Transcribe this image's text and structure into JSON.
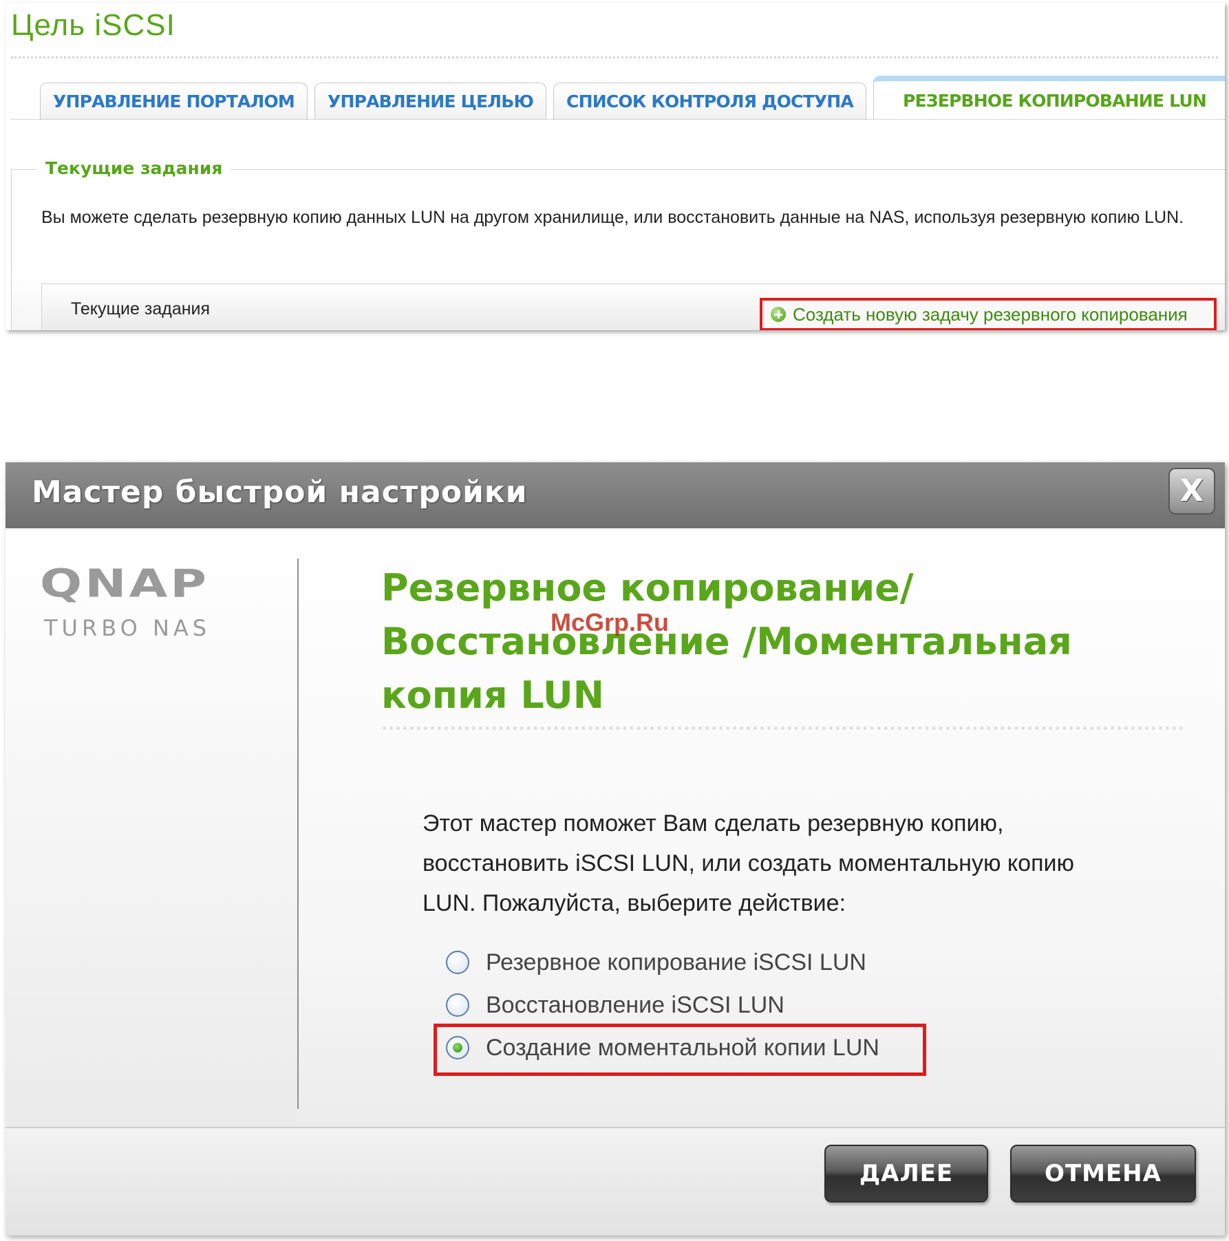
{
  "top_panel": {
    "title": "Цель iSCSI",
    "tabs": [
      {
        "label": "УПРАВЛЕНИЕ ПОРТАЛОМ",
        "active": false
      },
      {
        "label": "УПРАВЛЕНИЕ ЦЕЛЬЮ",
        "active": false
      },
      {
        "label": "СПИСОК КОНТРОЛЯ ДОСТУПА",
        "active": false
      },
      {
        "label": "РЕЗЕРВНОЕ КОПИРОВАНИЕ LUN",
        "active": true
      }
    ],
    "section_title": "Текущие задания",
    "description": "Вы можете сделать резервную копию данных LUN на другом хранилище, или восстановить данные на NAS, используя резервную копию LUN.",
    "jobs_label": "Текущие задания",
    "create_link": "Создать новую задачу резервного копирования"
  },
  "wizard": {
    "title": "Мастер быстрой настройки",
    "close_label": "X",
    "logo": "QNAP",
    "logo_sub": "TURBO NAS",
    "heading": "Резервное копирование/Восстановление /Моментальная копия LUN",
    "instructions": "Этот мастер поможет Вам сделать резервную копию, восстановить iSCSI LUN, или создать моментальную копию LUN. Пожалуйста, выберите действие:",
    "options": [
      {
        "label": "Резервное копирование iSCSI LUN",
        "selected": false
      },
      {
        "label": "Восстановление iSCSI LUN",
        "selected": false
      },
      {
        "label": "Создание моментальной копии LUN",
        "selected": true
      }
    ],
    "next_label": "ДАЛЕЕ",
    "cancel_label": "ОТМЕНА"
  },
  "watermark": "McGrp.Ru",
  "colors": {
    "accent_green": "#5aa61b",
    "tab_blue": "#2b79c6",
    "highlight_red": "#e01b1b"
  }
}
